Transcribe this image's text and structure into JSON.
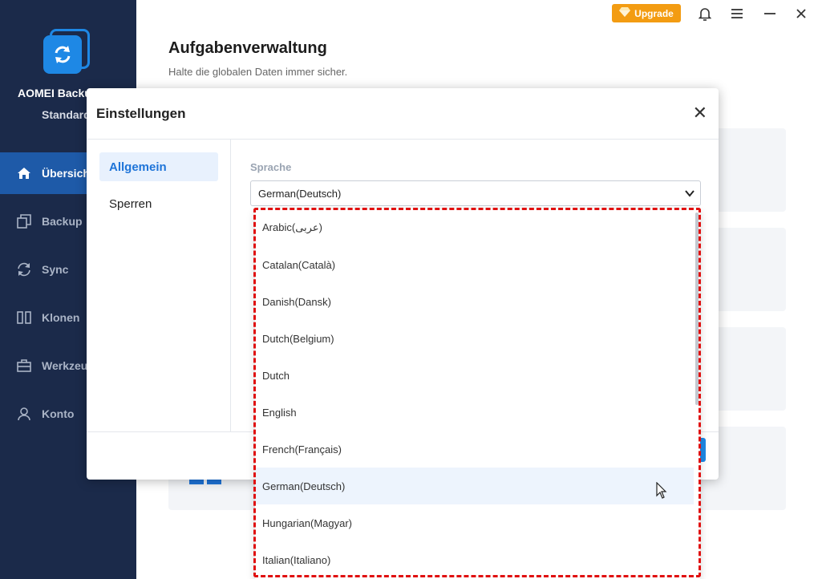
{
  "app": {
    "name": "AOMEI Backu",
    "edition": "Standard"
  },
  "sidebar": {
    "items": [
      {
        "label": "Übersicht",
        "icon": "home-icon",
        "active": true
      },
      {
        "label": "Backup",
        "icon": "backup-icon"
      },
      {
        "label": "Sync",
        "icon": "sync-icon"
      },
      {
        "label": "Klonen",
        "icon": "clone-icon"
      },
      {
        "label": "Werkzeuge",
        "icon": "tools-icon"
      },
      {
        "label": "Konto",
        "icon": "user-icon"
      }
    ]
  },
  "topbar": {
    "upgrade_label": "Upgrade",
    "icons": [
      "bell-icon",
      "menu-icon",
      "minimize-icon",
      "close-icon"
    ]
  },
  "main": {
    "title": "Aufgabenverwaltung",
    "subtitle": "Halte die globalen Daten immer sicher."
  },
  "dialog": {
    "title": "Einstellungen",
    "tabs": [
      {
        "label": "Allgemein",
        "active": true
      },
      {
        "label": "Sperren"
      }
    ],
    "language_label": "Sprache",
    "language_value": "German(Deutsch)"
  },
  "dropdown": {
    "selected": "German(Deutsch)",
    "options": [
      "Arabic(عربى)",
      "Catalan(Català)",
      "Danish(Dansk)",
      "Dutch(Belgium)",
      "Dutch",
      "English",
      "French(Français)",
      "German(Deutsch)",
      "Hungarian(Magyar)",
      "Italian(Italiano)"
    ]
  },
  "colors": {
    "sidebar_bg": "#1b2a4a",
    "accent": "#1e88e5",
    "upgrade": "#f39c12",
    "highlight": "#e01010"
  }
}
